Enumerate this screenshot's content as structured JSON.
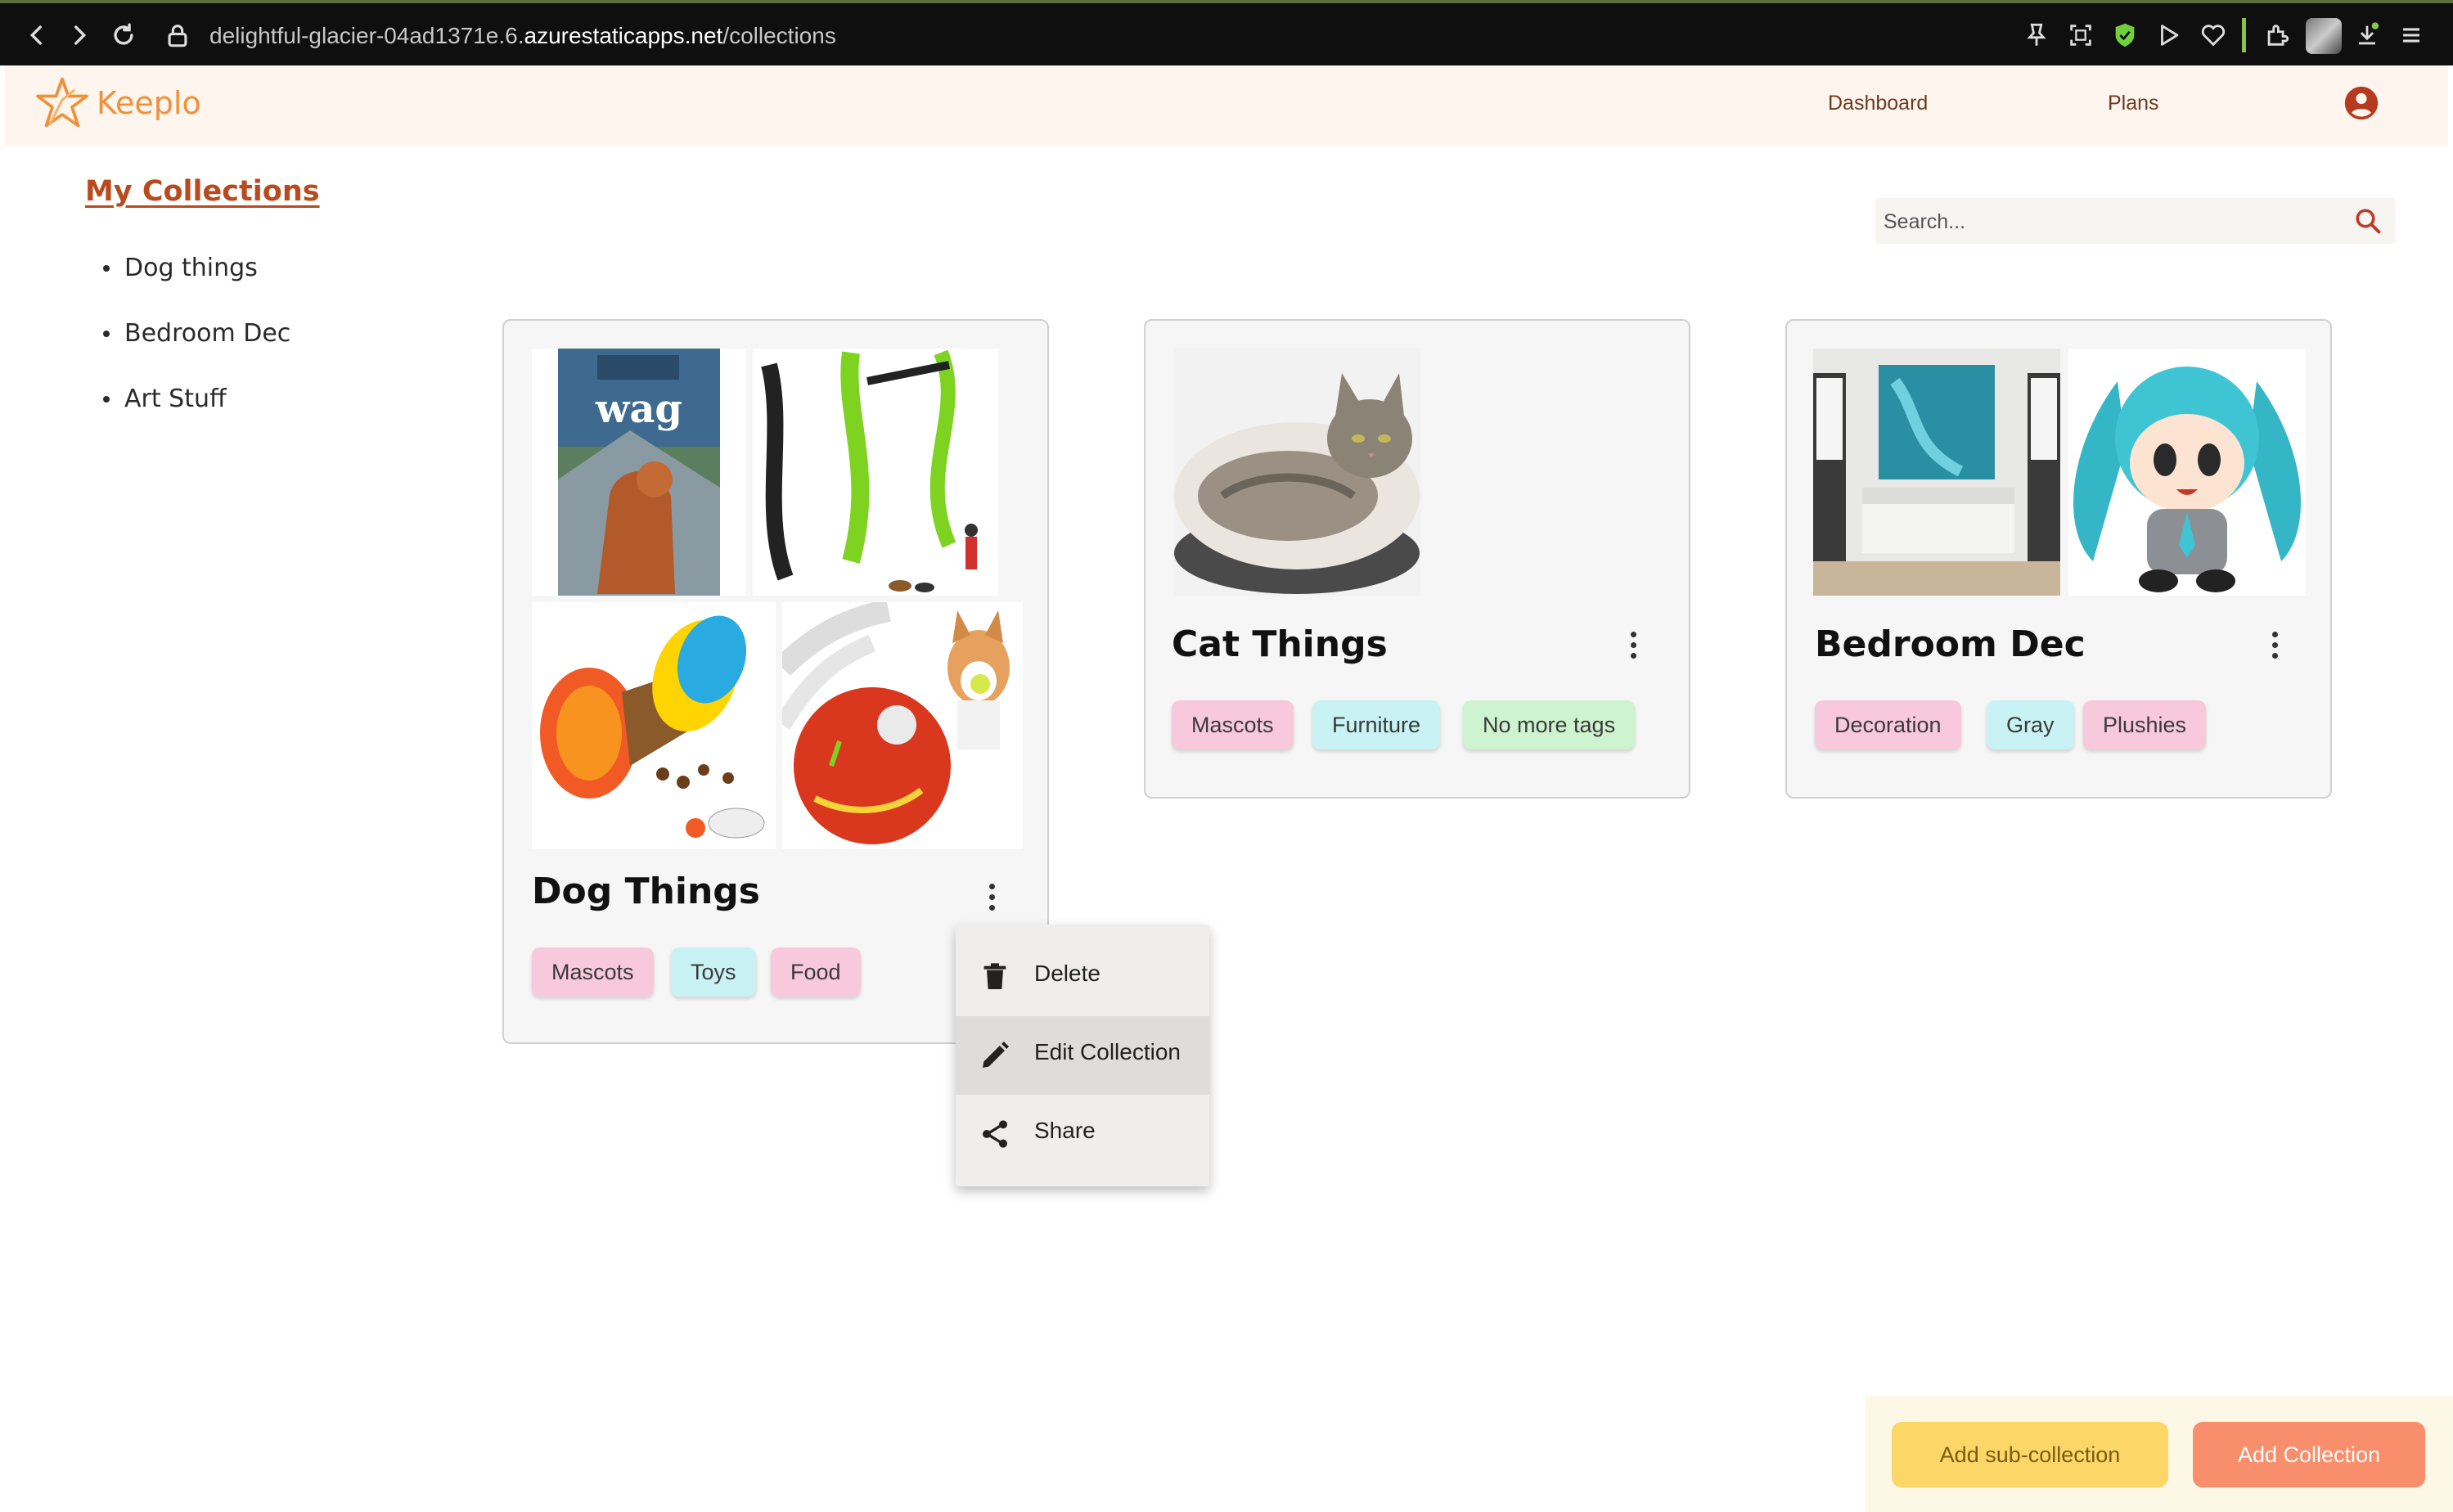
{
  "browser": {
    "url_prefix": "delightful-glacier-04ad1371e.6.",
    "url_domain": "azurestaticapps.net",
    "url_path": "/collections"
  },
  "header": {
    "brand": "Keeplo",
    "nav": [
      "Dashboard",
      "Plans"
    ],
    "accent_color": "#f0913a"
  },
  "sidebar": {
    "title": "My Collections",
    "items": [
      "Dog things",
      "Bedroom Dec",
      "Art Stuff"
    ]
  },
  "search": {
    "placeholder": "Search..."
  },
  "collections": [
    {
      "title": "Dog Things",
      "images": [
        "wag-dog-food-bag",
        "green-dog-leash",
        "treat-dispenser-toy",
        "orange-ball-toy-corgi"
      ],
      "tags": [
        {
          "label": "Mascots",
          "color": "#f8c8dc"
        },
        {
          "label": "Toys",
          "color": "#c9f2f4"
        },
        {
          "label": "Food",
          "color": "#f8c8dc"
        }
      ]
    },
    {
      "title": "Cat Things",
      "images": [
        "cat-in-bed"
      ],
      "tags": [
        {
          "label": "Mascots",
          "color": "#f8c8dc"
        },
        {
          "label": "Furniture",
          "color": "#c9f2f4"
        },
        {
          "label": "No more tags",
          "color": "#cdf3cf"
        }
      ]
    },
    {
      "title": "Bedroom Dec",
      "images": [
        "bedroom-with-painting",
        "hatsune-miku-plush"
      ],
      "tags": [
        {
          "label": "Decoration",
          "color": "#f8c8dc"
        },
        {
          "label": "Gray",
          "color": "#c9f2f4"
        },
        {
          "label": "Plushies",
          "color": "#f8c8dc"
        }
      ]
    }
  ],
  "context_menu": {
    "items": [
      "Delete",
      "Edit Collection",
      "Share"
    ],
    "hovered": "Edit Collection"
  },
  "actions": {
    "add_sub": "Add sub-collection",
    "add": "Add Collection",
    "add_sub_color": "#fcd768",
    "add_color": "#f98e6c"
  }
}
